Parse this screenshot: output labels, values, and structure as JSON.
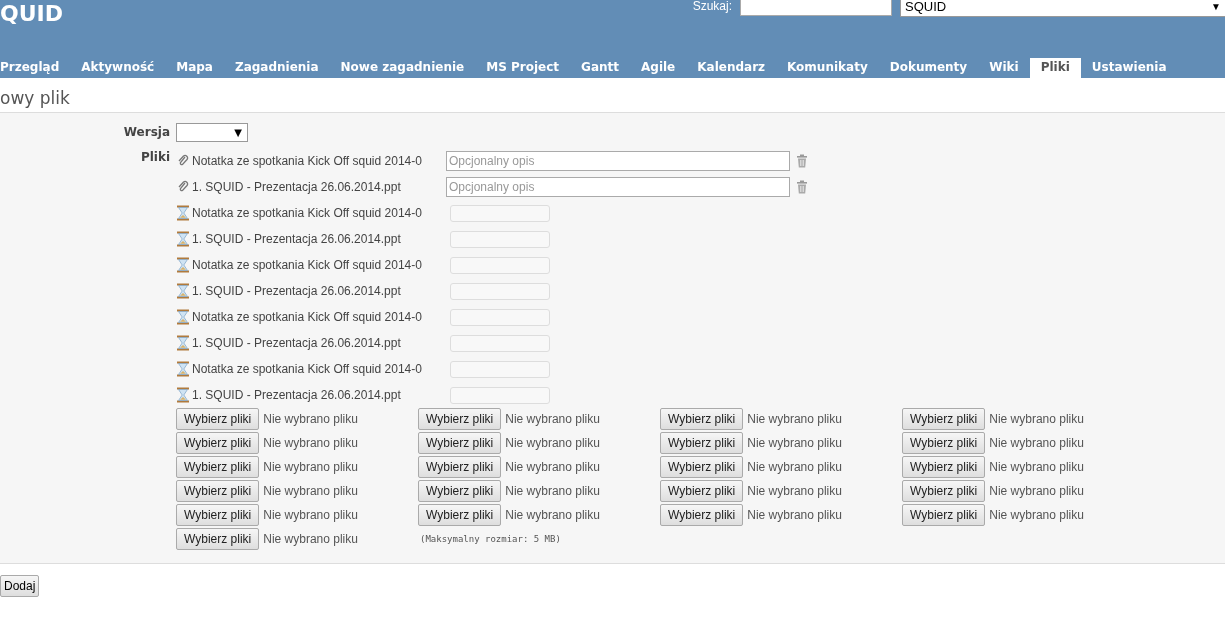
{
  "header": {
    "title": "QUID",
    "search_label": "Szukaj:",
    "project_select": {
      "value": "SQUID",
      "arrow": "▼"
    }
  },
  "tabs": [
    {
      "label": "Przegląd",
      "selected": false
    },
    {
      "label": "Aktywność",
      "selected": false
    },
    {
      "label": "Mapa",
      "selected": false
    },
    {
      "label": "Zagadnienia",
      "selected": false
    },
    {
      "label": "Nowe zagadnienie",
      "selected": false
    },
    {
      "label": "MS Project",
      "selected": false
    },
    {
      "label": "Gantt",
      "selected": false
    },
    {
      "label": "Agile",
      "selected": false
    },
    {
      "label": "Kalendarz",
      "selected": false
    },
    {
      "label": "Komunikaty",
      "selected": false
    },
    {
      "label": "Dokumenty",
      "selected": false
    },
    {
      "label": "Wiki",
      "selected": false
    },
    {
      "label": "Pliki",
      "selected": true
    },
    {
      "label": "Ustawienia",
      "selected": false
    }
  ],
  "page_title": "owy plik",
  "form": {
    "version_label": "Wersja",
    "version_select": {
      "arrow": "▼"
    },
    "files_label": "Pliki",
    "files": [
      {
        "kind": "attached",
        "name": "Notatka ze spotkania Kick Off squid 2014-0",
        "placeholder": "Opcjonalny opis",
        "disabled": false
      },
      {
        "kind": "attached",
        "name": "1. SQUID - Prezentacja 26.06.2014.ppt",
        "placeholder": "Opcjonalny opis",
        "disabled": false
      },
      {
        "kind": "pending",
        "name": "Notatka ze spotkania Kick Off squid 2014-0",
        "disabled": true
      },
      {
        "kind": "pending",
        "name": "1. SQUID - Prezentacja 26.06.2014.ppt",
        "disabled": true
      },
      {
        "kind": "pending",
        "name": "Notatka ze spotkania Kick Off squid 2014-0",
        "disabled": true
      },
      {
        "kind": "pending",
        "name": "1. SQUID - Prezentacja 26.06.2014.ppt",
        "disabled": true
      },
      {
        "kind": "pending",
        "name": "Notatka ze spotkania Kick Off squid 2014-0",
        "disabled": true
      },
      {
        "kind": "pending",
        "name": "1. SQUID - Prezentacja 26.06.2014.ppt",
        "disabled": true
      },
      {
        "kind": "pending",
        "name": "Notatka ze spotkania Kick Off squid 2014-0",
        "disabled": true
      },
      {
        "kind": "pending",
        "name": "1. SQUID - Prezentacja 26.06.2014.ppt",
        "disabled": true
      }
    ],
    "pickers": [
      {
        "button": "Wybierz pliki",
        "status": "Nie wybrano pliku"
      },
      {
        "button": "Wybierz pliki",
        "status": "Nie wybrano pliku"
      },
      {
        "button": "Wybierz pliki",
        "status": "Nie wybrano pliku"
      },
      {
        "button": "Wybierz pliki",
        "status": "Nie wybrano pliku"
      },
      {
        "button": "Wybierz pliki",
        "status": "Nie wybrano pliku"
      },
      {
        "button": "Wybierz pliki",
        "status": "Nie wybrano pliku"
      },
      {
        "button": "Wybierz pliki",
        "status": "Nie wybrano pliku"
      },
      {
        "button": "Wybierz pliki",
        "status": "Nie wybrano pliku"
      },
      {
        "button": "Wybierz pliki",
        "status": "Nie wybrano pliku"
      },
      {
        "button": "Wybierz pliki",
        "status": "Nie wybrano pliku"
      },
      {
        "button": "Wybierz pliki",
        "status": "Nie wybrano pliku"
      },
      {
        "button": "Wybierz pliki",
        "status": "Nie wybrano pliku"
      },
      {
        "button": "Wybierz pliki",
        "status": "Nie wybrano pliku"
      },
      {
        "button": "Wybierz pliki",
        "status": "Nie wybrano pliku"
      },
      {
        "button": "Wybierz pliki",
        "status": "Nie wybrano pliku"
      },
      {
        "button": "Wybierz pliki",
        "status": "Nie wybrano pliku"
      },
      {
        "button": "Wybierz pliki",
        "status": "Nie wybrano pliku"
      },
      {
        "button": "Wybierz pliki",
        "status": "Nie wybrano pliku"
      },
      {
        "button": "Wybierz pliki",
        "status": "Nie wybrano pliku"
      },
      {
        "button": "Wybierz pliki",
        "status": "Nie wybrano pliku"
      },
      {
        "button": "Wybierz pliki",
        "status": "Nie wybrano pliku"
      }
    ],
    "max_size_note": "(Maksymalny rozmiar: 5 MB)"
  },
  "submit_button": "Dodaj"
}
